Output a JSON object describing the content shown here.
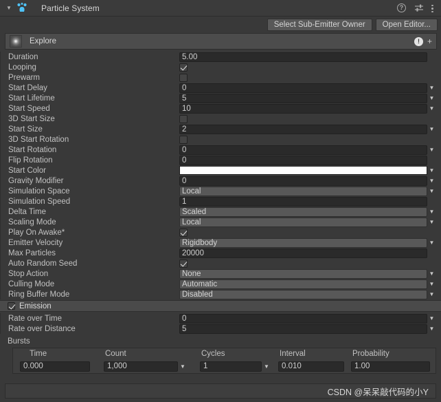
{
  "window": {
    "title": "Particle System",
    "foldout_icon": "triangle-down-icon",
    "component_icon": "particle-system-icon",
    "header_icons": [
      {
        "name": "help-icon",
        "glyph": "?"
      },
      {
        "name": "preset-icon",
        "glyph": ""
      },
      {
        "name": "more-menu-icon",
        "glyph": ""
      }
    ]
  },
  "toolbar": {
    "select_sub_emitter_owner": "Select Sub-Emitter Owner",
    "open_editor": "Open Editor..."
  },
  "explore": {
    "label": "Explore",
    "thumbnail_icon": "particle-thumbnail-icon",
    "warning_icon": "warning-icon",
    "warning_glyph": "!",
    "add_icon": "plus-icon",
    "add_glyph": "+"
  },
  "main": {
    "rows": [
      {
        "label": "Duration",
        "type": "field",
        "value": "5.00",
        "caret": false
      },
      {
        "label": "Looping",
        "type": "checkbox",
        "value": true
      },
      {
        "label": "Prewarm",
        "type": "checkbox",
        "value": false
      },
      {
        "label": "Start Delay",
        "type": "field",
        "value": "0",
        "caret": true
      },
      {
        "label": "Start Lifetime",
        "type": "field",
        "value": "5",
        "caret": true
      },
      {
        "label": "Start Speed",
        "type": "field",
        "value": "10",
        "caret": true
      },
      {
        "label": "3D Start Size",
        "type": "checkbox",
        "value": false
      },
      {
        "label": "Start Size",
        "type": "field",
        "value": "2",
        "caret": true
      },
      {
        "label": "3D Start Rotation",
        "type": "checkbox",
        "value": false
      },
      {
        "label": "Start Rotation",
        "type": "field",
        "value": "0",
        "caret": true
      },
      {
        "label": "Flip Rotation",
        "type": "field",
        "value": "0",
        "caret": false
      },
      {
        "label": "Start Color",
        "type": "color",
        "value": "#ffffff",
        "caret": true
      },
      {
        "label": "Gravity Modifier",
        "type": "field",
        "value": "0",
        "caret": true
      },
      {
        "label": "Simulation Space",
        "type": "popup",
        "value": "Local",
        "caret": true
      },
      {
        "label": "Simulation Speed",
        "type": "field",
        "value": "1",
        "caret": false
      },
      {
        "label": "Delta Time",
        "type": "popup",
        "value": "Scaled",
        "caret": true
      },
      {
        "label": "Scaling Mode",
        "type": "popup",
        "value": "Local",
        "caret": true
      },
      {
        "label": "Play On Awake*",
        "type": "checkbox",
        "value": true
      },
      {
        "label": "Emitter Velocity",
        "type": "popup",
        "value": "Rigidbody",
        "caret": true
      },
      {
        "label": "Max Particles",
        "type": "field",
        "value": "20000",
        "caret": false
      },
      {
        "label": "Auto Random Seed",
        "type": "checkbox",
        "value": true
      },
      {
        "label": "Stop Action",
        "type": "popup",
        "value": "None",
        "caret": true
      },
      {
        "label": "Culling Mode",
        "type": "popup",
        "value": "Automatic",
        "caret": true
      },
      {
        "label": "Ring Buffer Mode",
        "type": "popup",
        "value": "Disabled",
        "caret": true
      }
    ]
  },
  "emission": {
    "title": "Emission",
    "enabled": true,
    "rows": [
      {
        "label": "Rate over Time",
        "type": "field",
        "value": "0",
        "caret": true
      },
      {
        "label": "Rate over Distance",
        "type": "field",
        "value": "5",
        "caret": true
      }
    ],
    "bursts": {
      "label": "Bursts",
      "columns": [
        "Time",
        "Count",
        "Cycles",
        "Interval",
        "Probability"
      ],
      "rows": [
        {
          "time": "0.000",
          "count": "1,000",
          "cycles": "1",
          "interval": "0.010",
          "probability": "1.00"
        }
      ]
    }
  },
  "footer": {
    "watermark": "CSDN @呆呆敲代码的小Y"
  },
  "colors": {
    "background": "#393939",
    "header": "#3b3b3b",
    "section_header": "#4a4a4a",
    "field_bg": "#2a2a2a",
    "popup_bg": "#585858",
    "text": "#c2c2c2",
    "accent_icon": "#4fc3f7"
  }
}
